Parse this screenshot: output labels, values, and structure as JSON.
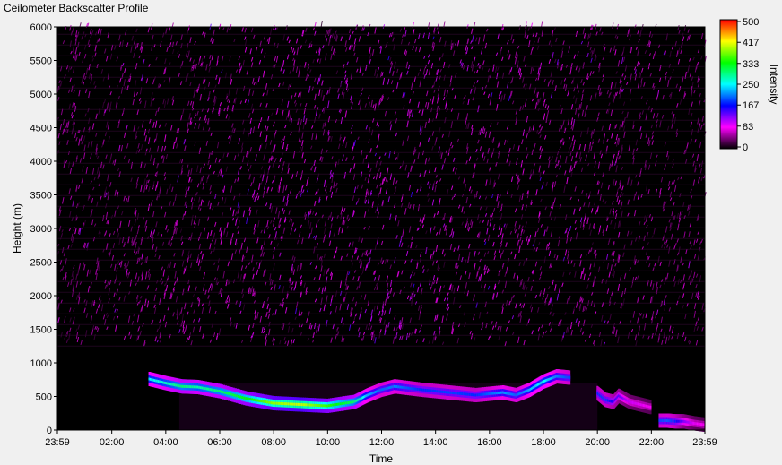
{
  "chart_data": {
    "type": "heatmap",
    "title": "Ceilometer Backscatter Profile",
    "xlabel": "Time",
    "ylabel": "Height (m)",
    "colorbar_label": "Intensity",
    "x_ticks": [
      "23:59",
      "02:00",
      "04:00",
      "06:00",
      "08:00",
      "10:00",
      "12:00",
      "14:00",
      "16:00",
      "18:00",
      "20:00",
      "22:00",
      "23:59"
    ],
    "xlim_hours": [
      -0.0167,
      23.983
    ],
    "ylim": [
      0,
      6000
    ],
    "y_ticks": [
      0,
      500,
      1000,
      1500,
      2000,
      2500,
      3000,
      3500,
      4000,
      4500,
      5000,
      5500,
      6000
    ],
    "colorbar_ticks": [
      0,
      83,
      167,
      250,
      333,
      417,
      500
    ],
    "colorbar_range": [
      0,
      500
    ],
    "colormap": [
      "#000000",
      "#ff00ff",
      "#0000ff",
      "#00ffff",
      "#00ff00",
      "#ffff00",
      "#ff0000"
    ],
    "layers": [
      {
        "hours": [
          3.4,
          4.0,
          4.6,
          5.2,
          6.0,
          7.0,
          8.0,
          9.0,
          10.0,
          11.0,
          11.5,
          12.0,
          12.5,
          13.5,
          14.5,
          15.5,
          16.5,
          17.0,
          17.5,
          18.0,
          18.5,
          19.0
        ],
        "heights": [
          760,
          700,
          650,
          640,
          580,
          470,
          400,
          380,
          360,
          420,
          520,
          600,
          650,
          600,
          560,
          520,
          560,
          520,
          600,
          720,
          800,
          780
        ],
        "intensity": [
          250,
          270,
          300,
          280,
          300,
          330,
          380,
          400,
          350,
          300,
          230,
          200,
          210,
          180,
          190,
          180,
          220,
          200,
          230,
          260,
          210,
          190
        ]
      },
      {
        "hours": [
          20.0,
          20.3,
          20.6,
          20.8,
          21.2,
          21.6,
          22.0
        ],
        "heights": [
          550,
          450,
          420,
          510,
          420,
          380,
          340
        ],
        "intensity": [
          180,
          190,
          160,
          140,
          100,
          90,
          80
        ]
      },
      {
        "hours": [
          22.3,
          22.6,
          22.9,
          23.2,
          23.6,
          23.98
        ],
        "heights": [
          140,
          140,
          130,
          130,
          100,
          80
        ],
        "intensity": [
          190,
          200,
          180,
          130,
          90,
          80
        ]
      }
    ]
  }
}
